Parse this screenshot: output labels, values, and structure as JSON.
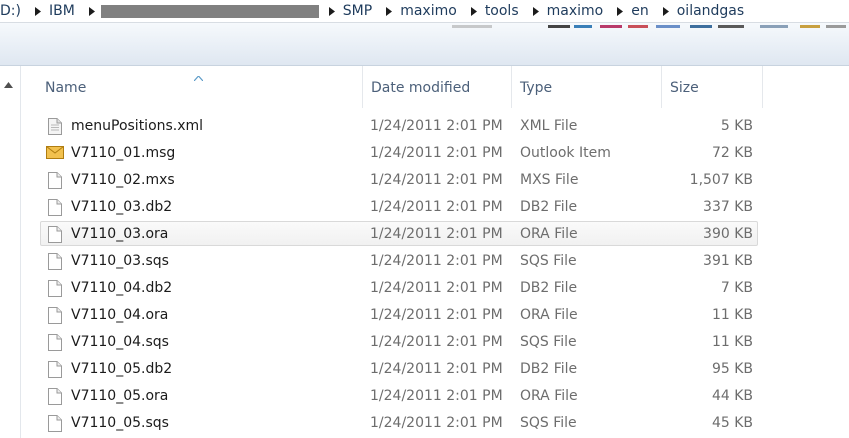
{
  "breadcrumb": {
    "items": [
      "D:)",
      "IBM",
      "SMP",
      "maximo",
      "tools",
      "maximo",
      "en",
      "oilandgas"
    ]
  },
  "columns": {
    "name": "Name",
    "date": "Date modified",
    "type": "Type",
    "size": "Size"
  },
  "files": [
    {
      "name": "menuPositions.xml",
      "date": "1/24/2011 2:01 PM",
      "type": "XML File",
      "size": "5 KB",
      "icon": "xml-file-icon"
    },
    {
      "name": "V7110_01.msg",
      "date": "1/24/2011 2:01 PM",
      "type": "Outlook Item",
      "size": "72 KB",
      "icon": "envelope-icon"
    },
    {
      "name": "V7110_02.mxs",
      "date": "1/24/2011 2:01 PM",
      "type": "MXS File",
      "size": "1,507 KB",
      "icon": "file-icon"
    },
    {
      "name": "V7110_03.db2",
      "date": "1/24/2011 2:01 PM",
      "type": "DB2 File",
      "size": "337 KB",
      "icon": "file-icon"
    },
    {
      "name": "V7110_03.ora",
      "date": "1/24/2011 2:01 PM",
      "type": "ORA File",
      "size": "390 KB",
      "icon": "file-icon"
    },
    {
      "name": "V7110_03.sqs",
      "date": "1/24/2011 2:01 PM",
      "type": "SQS File",
      "size": "391 KB",
      "icon": "file-icon"
    },
    {
      "name": "V7110_04.db2",
      "date": "1/24/2011 2:01 PM",
      "type": "DB2 File",
      "size": "7 KB",
      "icon": "file-icon"
    },
    {
      "name": "V7110_04.ora",
      "date": "1/24/2011 2:01 PM",
      "type": "ORA File",
      "size": "11 KB",
      "icon": "file-icon"
    },
    {
      "name": "V7110_04.sqs",
      "date": "1/24/2011 2:01 PM",
      "type": "SQS File",
      "size": "11 KB",
      "icon": "file-icon"
    },
    {
      "name": "V7110_05.db2",
      "date": "1/24/2011 2:01 PM",
      "type": "DB2 File",
      "size": "95 KB",
      "icon": "file-icon"
    },
    {
      "name": "V7110_05.ora",
      "date": "1/24/2011 2:01 PM",
      "type": "ORA File",
      "size": "44 KB",
      "icon": "file-icon"
    },
    {
      "name": "V7110_05.sqs",
      "date": "1/24/2011 2:01 PM",
      "type": "SQS File",
      "size": "45 KB",
      "icon": "file-icon"
    }
  ],
  "colors": {
    "hover_row_border": "#d9d9d9",
    "header_text": "#4c607a",
    "crumb_text": "#1e3b5c"
  }
}
